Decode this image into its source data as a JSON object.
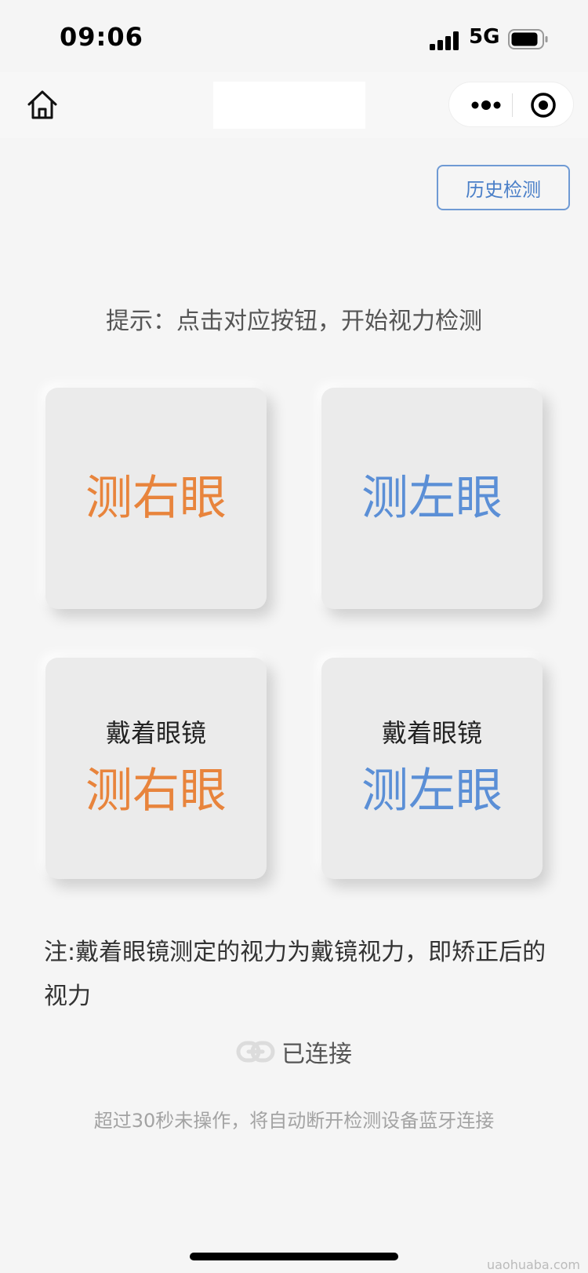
{
  "status_bar": {
    "time": "09:06",
    "network": "5G",
    "icons": [
      "signal-icon",
      "battery-icon"
    ]
  },
  "nav": {
    "icons": [
      "home-icon",
      "more-icon",
      "close-circle-icon"
    ]
  },
  "history_button": {
    "label": "历史检测",
    "color": "#4a7fc8"
  },
  "hint": "提示：点击对应按钮，开始视力检测",
  "cards": [
    {
      "sub": "",
      "label": "测右眼",
      "color": "#e8843c"
    },
    {
      "sub": "",
      "label": "测左眼",
      "color": "#5b8fd6"
    },
    {
      "sub": "戴着眼镜",
      "label": "测右眼",
      "color": "#e8843c"
    },
    {
      "sub": "戴着眼镜",
      "label": "测左眼",
      "color": "#5b8fd6"
    }
  ],
  "note": "注:戴着眼镜测定的视力为戴镜视力，即矫正后的视力",
  "connection": {
    "icon": "link-icon",
    "status": "已连接"
  },
  "warning": "超过30秒未操作，将自动断开检测设备蓝牙连接",
  "watermark": "uaohuaba.com"
}
